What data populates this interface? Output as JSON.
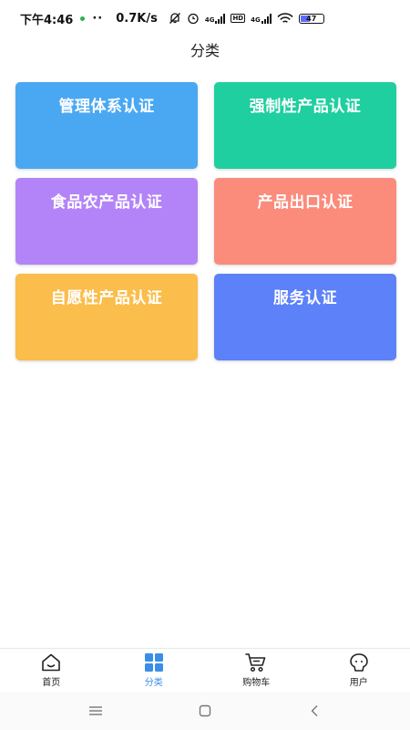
{
  "status_bar": {
    "time": "下午4:46",
    "dots": "··",
    "speed": "0.7K/s",
    "sig1_label": "4G",
    "hd_label": "HD",
    "sig2_label": "4G",
    "battery_level": "47"
  },
  "header": {
    "title": "分类"
  },
  "categories": [
    {
      "label": "管理体系认证",
      "color": "#4aa8f3"
    },
    {
      "label": "强制性产品认证",
      "color": "#1fcf9f"
    },
    {
      "label": "食品农产品认证",
      "color": "#b384f7"
    },
    {
      "label": "产品出口认证",
      "color": "#fb8b7b"
    },
    {
      "label": "自愿性产品认证",
      "color": "#fbbd4b"
    },
    {
      "label": "服务认证",
      "color": "#5c81f8"
    }
  ],
  "bottom_nav": {
    "active_color": "#3a8ee6",
    "items": [
      {
        "label": "首页",
        "icon": "home-icon"
      },
      {
        "label": "分类",
        "icon": "grid-icon"
      },
      {
        "label": "购物车",
        "icon": "cart-icon"
      },
      {
        "label": "用户",
        "icon": "user-icon"
      }
    ]
  },
  "system_nav": {
    "icons": [
      "menu-icon",
      "home-square-icon",
      "back-icon"
    ]
  }
}
